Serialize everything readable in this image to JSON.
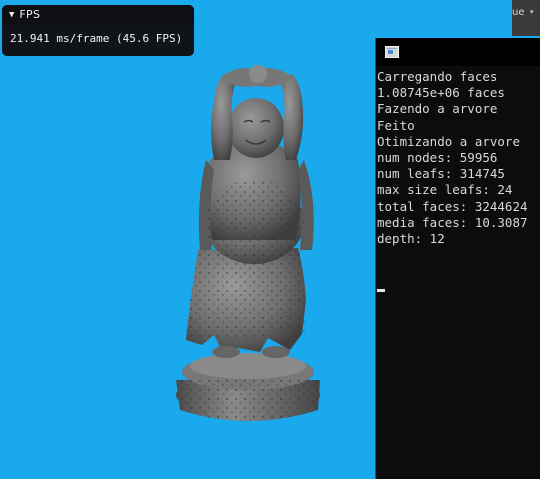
{
  "fps_window": {
    "collapse_glyph": "▼",
    "title": "FPS",
    "stats": "21.941 ms/frame (45.6 FPS)"
  },
  "top_widget": {
    "text": "ue",
    "arrow": "▾"
  },
  "console": {
    "lines": [
      "Carregando faces",
      "1.08745e+06 faces",
      "Fazendo a arvore",
      "Feito",
      "Otimizando a arvore",
      "num nodes: 59956",
      "num leafs: 314745",
      "max size leafs: 24",
      "total faces: 3244624",
      "media faces: 10.3087",
      "depth: 12"
    ]
  },
  "colors": {
    "background": "#1aa9ec",
    "statue": "#6e6e6e",
    "console_bg": "#0c0c0c",
    "console_text": "#d9d9d9",
    "panel_bg": "#101418"
  },
  "icons": {
    "console_app": "console-app-icon",
    "statue": "buddha-statue-3d-model"
  }
}
